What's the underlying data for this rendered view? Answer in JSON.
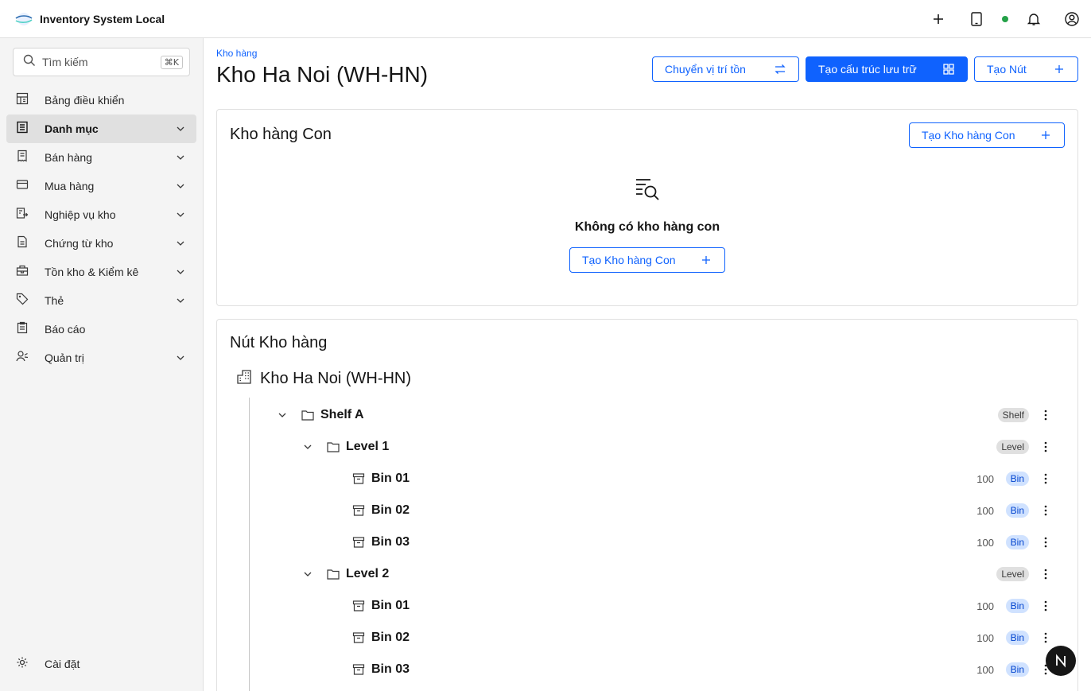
{
  "app": {
    "title": "Inventory System Local"
  },
  "header": {
    "status_color": "#24a148"
  },
  "sidebar": {
    "search_placeholder": "Tìm kiếm",
    "search_shortcut": "⌘K",
    "items": [
      {
        "label": "Bảng điều khiển",
        "icon": "dashboard-icon",
        "expandable": false
      },
      {
        "label": "Danh mục",
        "icon": "catalog-icon",
        "expandable": true,
        "active": true
      },
      {
        "label": "Bán hàng",
        "icon": "receipt-icon",
        "expandable": true
      },
      {
        "label": "Mua hàng",
        "icon": "credit-card-icon",
        "expandable": true
      },
      {
        "label": "Nghiệp vụ kho",
        "icon": "warehouse-ops-icon",
        "expandable": true
      },
      {
        "label": "Chứng từ kho",
        "icon": "document-icon",
        "expandable": true
      },
      {
        "label": "Tồn kho & Kiểm kê",
        "icon": "inventory-icon",
        "expandable": true
      },
      {
        "label": "Thẻ",
        "icon": "tag-icon",
        "expandable": true
      },
      {
        "label": "Báo cáo",
        "icon": "report-icon",
        "expandable": false
      },
      {
        "label": "Quản trị",
        "icon": "admin-icon",
        "expandable": true
      }
    ],
    "settings_label": "Cài đặt"
  },
  "page": {
    "breadcrumb": "Kho hàng",
    "title": "Kho Ha Noi (WH-HN)",
    "actions": {
      "move": "Chuyển vị trí tồn",
      "create_structure": "Tạo cấu trúc lưu trữ",
      "create_node": "Tạo Nút"
    }
  },
  "child_warehouses": {
    "title": "Kho hàng Con",
    "create_button": "Tạo Kho hàng Con",
    "empty_title": "Không có kho hàng con",
    "empty_button": "Tạo Kho hàng Con"
  },
  "nodes": {
    "title": "Nút Kho hàng",
    "root": "Kho Ha Noi (WH-HN)",
    "rows": [
      {
        "name": "Shelf A",
        "type": "Shelf",
        "qty": "",
        "level": 0,
        "kind": "folder",
        "expandable": true
      },
      {
        "name": "Level 1",
        "type": "Level",
        "qty": "",
        "level": 1,
        "kind": "folder",
        "expandable": true
      },
      {
        "name": "Bin 01",
        "type": "Bin",
        "qty": "100",
        "level": 2,
        "kind": "bin",
        "expandable": false
      },
      {
        "name": "Bin 02",
        "type": "Bin",
        "qty": "100",
        "level": 2,
        "kind": "bin",
        "expandable": false
      },
      {
        "name": "Bin 03",
        "type": "Bin",
        "qty": "100",
        "level": 2,
        "kind": "bin",
        "expandable": false
      },
      {
        "name": "Level 2",
        "type": "Level",
        "qty": "",
        "level": 1,
        "kind": "folder",
        "expandable": true
      },
      {
        "name": "Bin 01",
        "type": "Bin",
        "qty": "100",
        "level": 2,
        "kind": "bin",
        "expandable": false
      },
      {
        "name": "Bin 02",
        "type": "Bin",
        "qty": "100",
        "level": 2,
        "kind": "bin",
        "expandable": false
      },
      {
        "name": "Bin 03",
        "type": "Bin",
        "qty": "100",
        "level": 2,
        "kind": "bin",
        "expandable": false
      }
    ]
  },
  "fab": {
    "label": "N"
  }
}
